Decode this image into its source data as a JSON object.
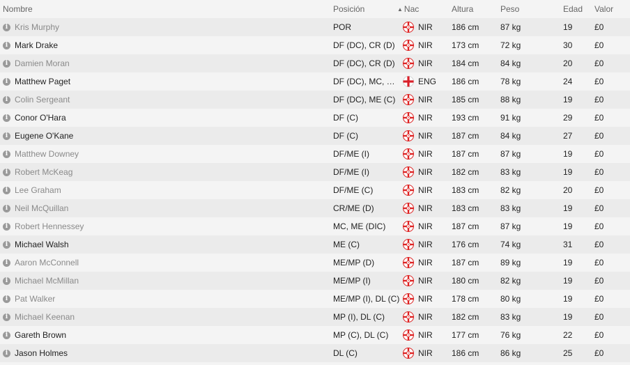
{
  "headers": {
    "name": "Nombre",
    "position": "Posición",
    "nationality": "Nac",
    "height": "Altura",
    "weight": "Peso",
    "age": "Edad",
    "value": "Valor"
  },
  "flag_icons": {
    "NIR": "nir-flag-icon",
    "ENG": "eng-flag-icon"
  },
  "players": [
    {
      "name": "Kris Murphy",
      "position": "POR",
      "nat": "NIR",
      "height": "186 cm",
      "weight": "87 kg",
      "age": "19",
      "value": "£0",
      "dim": true
    },
    {
      "name": "Mark Drake",
      "position": "DF (DC), CR (D)",
      "nat": "NIR",
      "height": "173 cm",
      "weight": "72 kg",
      "age": "30",
      "value": "£0",
      "dim": false
    },
    {
      "name": "Damien Moran",
      "position": "DF (DC), CR (D)",
      "nat": "NIR",
      "height": "184 cm",
      "weight": "84 kg",
      "age": "20",
      "value": "£0",
      "dim": true
    },
    {
      "name": "Matthew Paget",
      "position": "DF (DC), MC, M...",
      "nat": "ENG",
      "height": "186 cm",
      "weight": "78 kg",
      "age": "24",
      "value": "£0",
      "dim": false
    },
    {
      "name": "Colin Sergeant",
      "position": "DF (DC), ME (C)",
      "nat": "NIR",
      "height": "185 cm",
      "weight": "88 kg",
      "age": "19",
      "value": "£0",
      "dim": true
    },
    {
      "name": "Conor O'Hara",
      "position": "DF (C)",
      "nat": "NIR",
      "height": "193 cm",
      "weight": "91 kg",
      "age": "29",
      "value": "£0",
      "dim": false
    },
    {
      "name": "Eugene O'Kane",
      "position": "DF (C)",
      "nat": "NIR",
      "height": "187 cm",
      "weight": "84 kg",
      "age": "27",
      "value": "£0",
      "dim": false
    },
    {
      "name": "Matthew Downey",
      "position": "DF/ME (I)",
      "nat": "NIR",
      "height": "187 cm",
      "weight": "87 kg",
      "age": "19",
      "value": "£0",
      "dim": true
    },
    {
      "name": "Robert McKeag",
      "position": "DF/ME (I)",
      "nat": "NIR",
      "height": "182 cm",
      "weight": "83 kg",
      "age": "19",
      "value": "£0",
      "dim": true
    },
    {
      "name": "Lee Graham",
      "position": "DF/ME (C)",
      "nat": "NIR",
      "height": "183 cm",
      "weight": "82 kg",
      "age": "20",
      "value": "£0",
      "dim": true
    },
    {
      "name": "Neil McQuillan",
      "position": "CR/ME (D)",
      "nat": "NIR",
      "height": "183 cm",
      "weight": "83 kg",
      "age": "19",
      "value": "£0",
      "dim": true
    },
    {
      "name": "Robert Hennessey",
      "position": "MC, ME (DIC)",
      "nat": "NIR",
      "height": "187 cm",
      "weight": "87 kg",
      "age": "19",
      "value": "£0",
      "dim": true
    },
    {
      "name": "Michael Walsh",
      "position": "ME (C)",
      "nat": "NIR",
      "height": "176 cm",
      "weight": "74 kg",
      "age": "31",
      "value": "£0",
      "dim": false
    },
    {
      "name": "Aaron McConnell",
      "position": "ME/MP (D)",
      "nat": "NIR",
      "height": "187 cm",
      "weight": "89 kg",
      "age": "19",
      "value": "£0",
      "dim": true
    },
    {
      "name": "Michael McMillan",
      "position": "ME/MP (I)",
      "nat": "NIR",
      "height": "180 cm",
      "weight": "82 kg",
      "age": "19",
      "value": "£0",
      "dim": true
    },
    {
      "name": "Pat Walker",
      "position": "ME/MP (I), DL (C)",
      "nat": "NIR",
      "height": "178 cm",
      "weight": "80 kg",
      "age": "19",
      "value": "£0",
      "dim": true
    },
    {
      "name": "Michael Keenan",
      "position": "MP (I), DL (C)",
      "nat": "NIR",
      "height": "182 cm",
      "weight": "83 kg",
      "age": "19",
      "value": "£0",
      "dim": true
    },
    {
      "name": "Gareth Brown",
      "position": "MP (C), DL (C)",
      "nat": "NIR",
      "height": "177 cm",
      "weight": "76 kg",
      "age": "22",
      "value": "£0",
      "dim": false
    },
    {
      "name": "Jason Holmes",
      "position": "DL (C)",
      "nat": "NIR",
      "height": "186 cm",
      "weight": "86 kg",
      "age": "25",
      "value": "£0",
      "dim": false
    }
  ]
}
